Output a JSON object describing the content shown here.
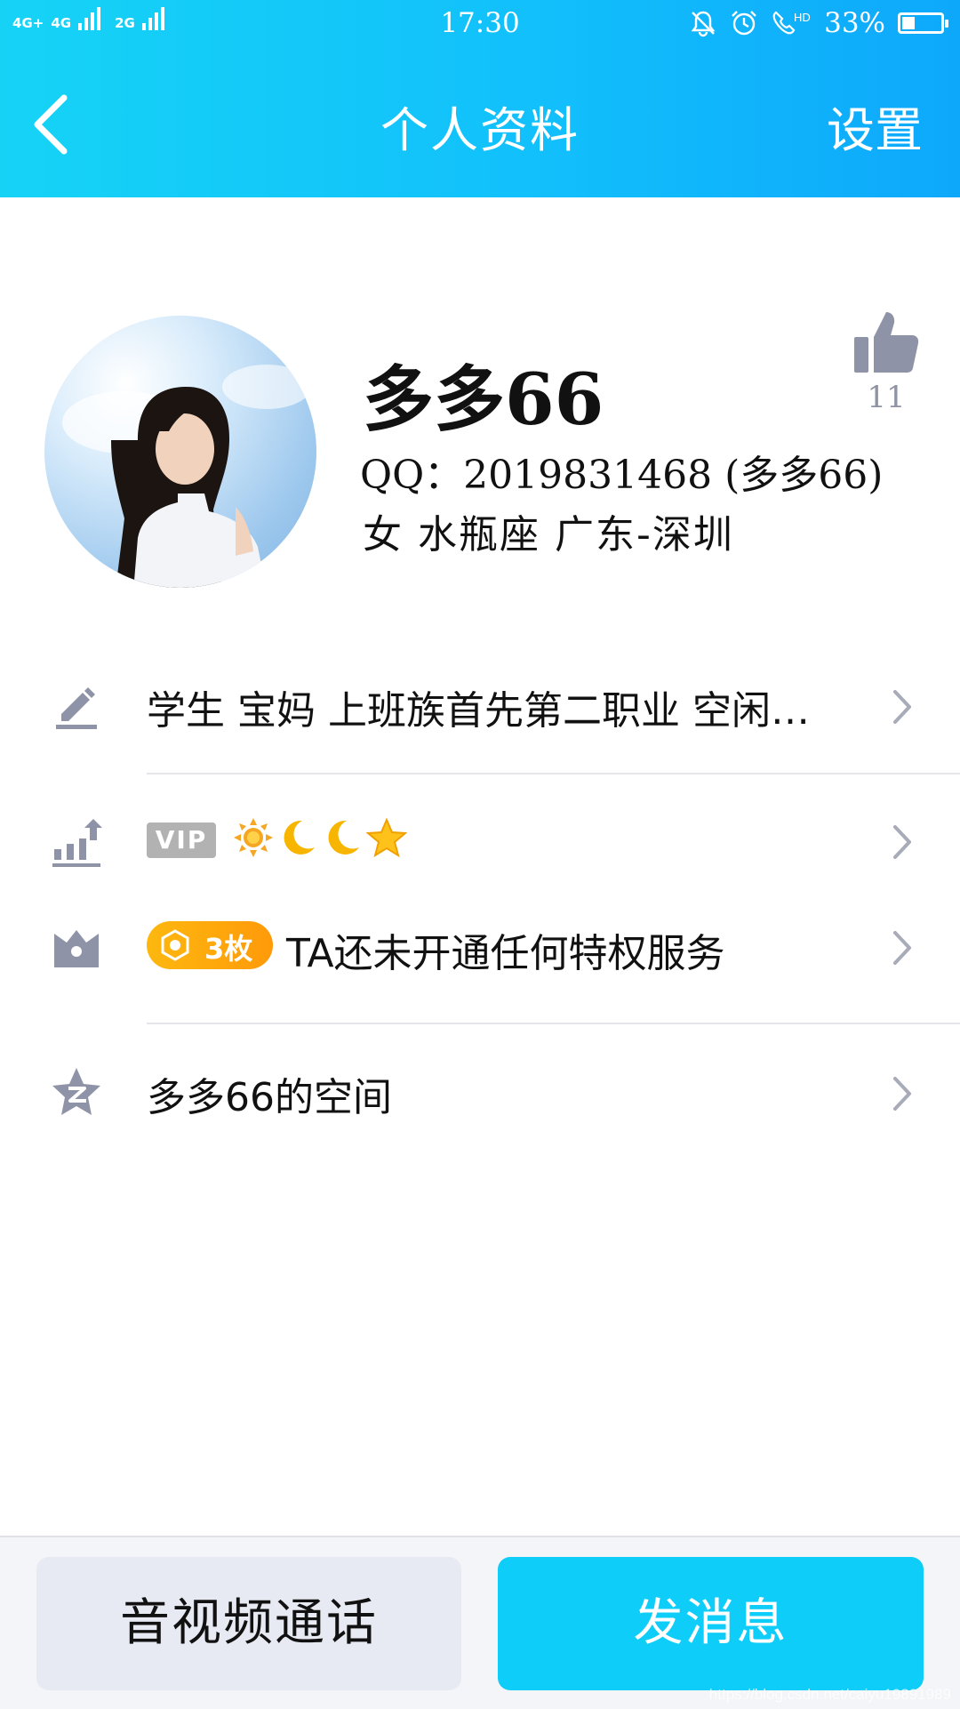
{
  "status_bar": {
    "network": [
      "4G+",
      "4G",
      "2G"
    ],
    "time": "17:30",
    "battery_percent": "33%",
    "battery_level": 0.33
  },
  "nav": {
    "title": "个人资料",
    "settings_label": "设置"
  },
  "profile": {
    "name": "多多66",
    "qq_line": "QQ：2019831468 (多多66)",
    "info_line": "女  水瓶座  广东-深圳",
    "likes": "11"
  },
  "rows": {
    "occupation": "学生 宝妈 上班族首先第二职业 空闲…",
    "vip_label": "VIP",
    "vip_level_icons": [
      "sun-icon",
      "moon-icon",
      "moon-icon",
      "star-icon"
    ],
    "medal_count": "3枚",
    "privilege_text": "TA还未开通任何特权服务",
    "space_label": "多多66的空间"
  },
  "bottom": {
    "call_label": "音视频通话",
    "message_label": "发消息"
  },
  "watermark": "https://blog.csdn.net/caiyu19891989",
  "colors": {
    "header_gradient_start": "#16d3f6",
    "header_gradient_end": "#0ea8fb",
    "message_button": "#0ecdf8",
    "icon_gray": "#8f93a8",
    "medal_orange": "#ffa70c"
  }
}
